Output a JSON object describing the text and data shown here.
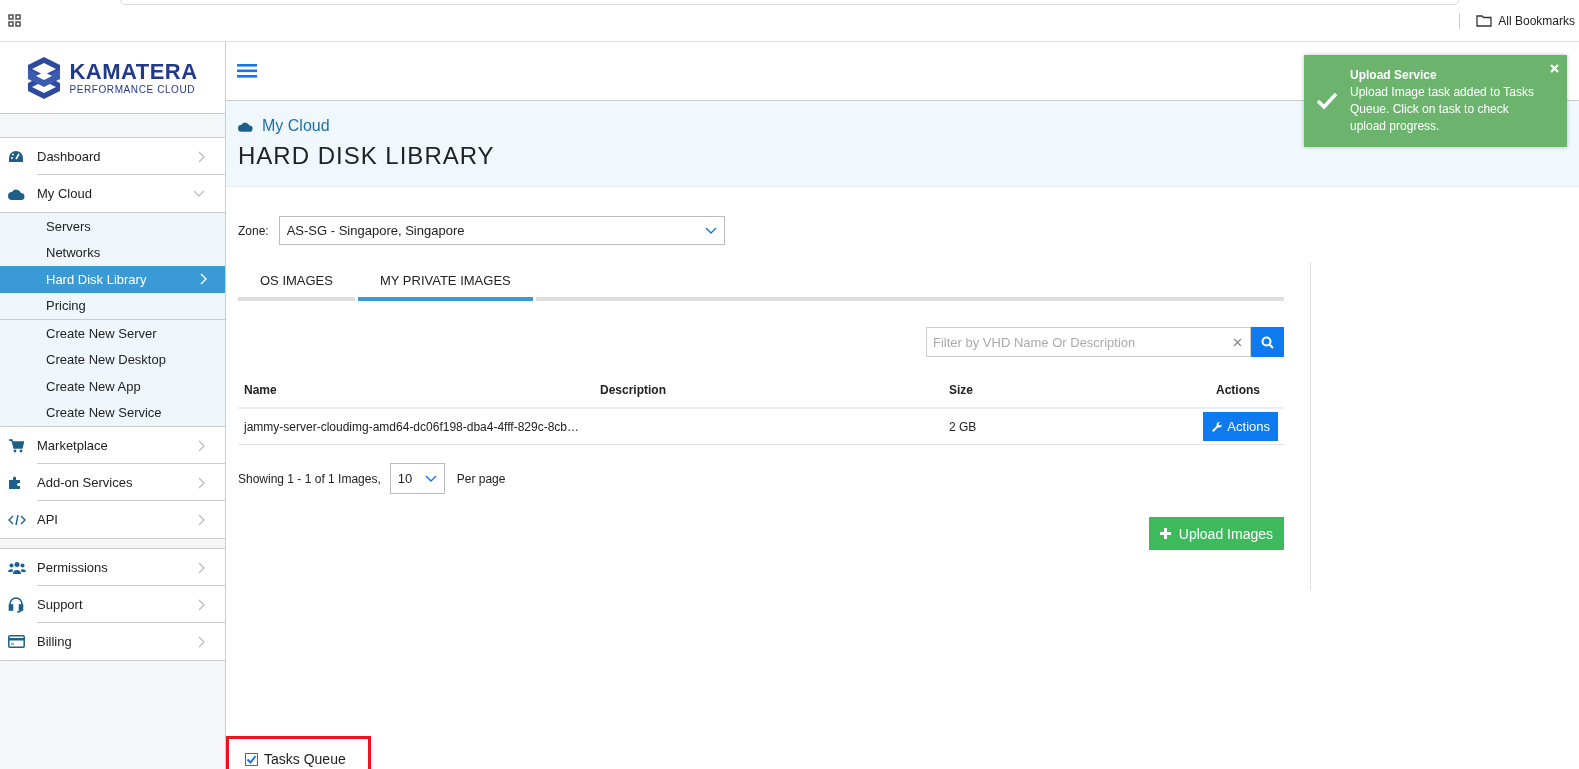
{
  "browser_bar": {
    "bookmarks_label": "All Bookmarks"
  },
  "logo": {
    "name": "KAMATERA",
    "tagline": "PERFORMANCE CLOUD"
  },
  "sidebar": {
    "sections": [
      {
        "items": [
          {
            "label": "Dashboard",
            "expanded": false
          },
          {
            "label": "My Cloud",
            "expanded": true,
            "child_groups": [
              [
                {
                  "label": "Servers",
                  "selected": false
                },
                {
                  "label": "Networks",
                  "selected": false
                },
                {
                  "label": "Hard Disk Library",
                  "selected": true
                },
                {
                  "label": "Pricing",
                  "selected": false
                }
              ],
              [
                {
                  "label": "Create New Server",
                  "selected": false
                },
                {
                  "label": "Create New Desktop",
                  "selected": false
                },
                {
                  "label": "Create New App",
                  "selected": false
                },
                {
                  "label": "Create New Service",
                  "selected": false
                }
              ]
            ]
          },
          {
            "label": "Marketplace",
            "expanded": false
          },
          {
            "label": "Add-on Services",
            "expanded": false
          },
          {
            "label": "API",
            "expanded": false
          }
        ]
      },
      {
        "items": [
          {
            "label": "Permissions",
            "expanded": false
          },
          {
            "label": "Support",
            "expanded": false
          },
          {
            "label": "Billing",
            "expanded": false
          }
        ]
      }
    ]
  },
  "breadcrumb": "My Cloud",
  "page_title": "HARD DISK LIBRARY",
  "zone": {
    "label": "Zone:",
    "value": "AS-SG - Singapore, Singapore"
  },
  "tabs": [
    {
      "label": "OS IMAGES",
      "selected": false
    },
    {
      "label": "MY PRIVATE IMAGES",
      "selected": true
    }
  ],
  "filter": {
    "placeholder": "Filter by VHD Name Or Description"
  },
  "table": {
    "columns": [
      "Name",
      "Description",
      "Size",
      "Actions"
    ],
    "rows": [
      {
        "name": "jammy-server-cloudimg-amd64-dc06f198-dba4-4fff-829c-8cb…",
        "description": "",
        "size": "2 GB",
        "action": "Actions"
      }
    ]
  },
  "pagination": {
    "summary": "Showing 1 - 1 of 1 Images,",
    "per_page": "10",
    "per_page_label": "Per page"
  },
  "upload_button": "Upload Images",
  "toast": {
    "title": "Upload Service",
    "message": "Upload Image task added to Tasks Queue. Click on task to check upload progress."
  },
  "tasks_queue": {
    "label": "Tasks Queue",
    "checked": true
  }
}
